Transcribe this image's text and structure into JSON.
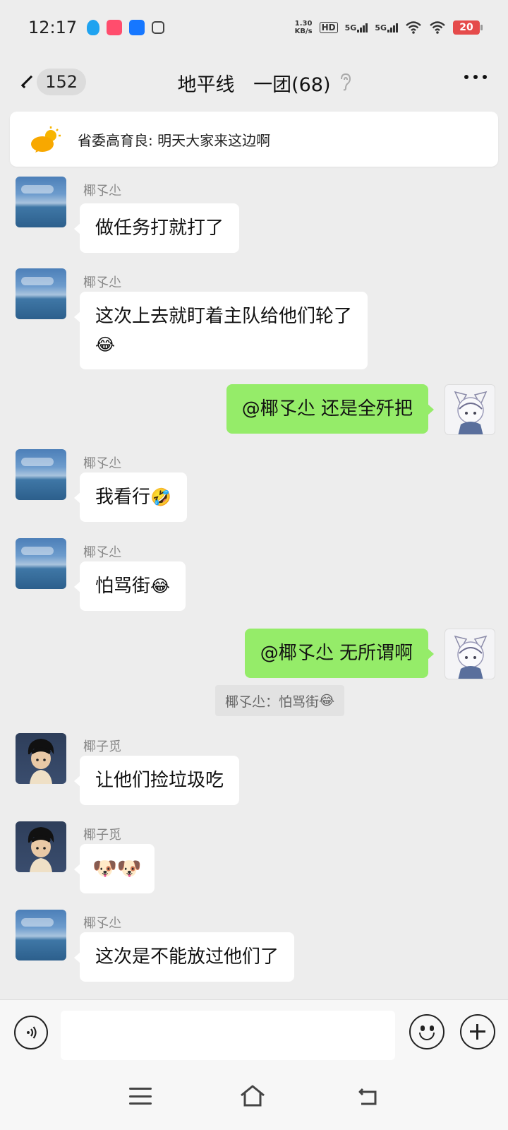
{
  "status_bar": {
    "time": "12:17",
    "net_speed_value": "1.30",
    "net_speed_unit": "KB/s",
    "hd_label": "HD",
    "signal_1": "5G",
    "signal_2": "5G",
    "battery": "20",
    "colors": {
      "battery": "#e54b4b"
    }
  },
  "nav": {
    "back_count": "152",
    "title": "地平线 一团(68)"
  },
  "pinned": {
    "text": "省委高育良: 明天大家来这边啊"
  },
  "messages": [
    {
      "side": "left",
      "sender": "椰孓尐",
      "text": "做任务打就打了",
      "avatar": "sky-sea-avatar"
    },
    {
      "side": "left",
      "sender": "椰孓尐",
      "text": "这次上去就盯着主队给他们轮了",
      "emoji": "😂",
      "avatar": "sky-sea-avatar"
    },
    {
      "side": "right",
      "text": "@椰孓尐  还是全歼把",
      "avatar": "anime-girl-avatar"
    },
    {
      "side": "left",
      "sender": "椰孓尐",
      "text": "我看行",
      "emoji": "🤣",
      "avatar": "sky-sea-avatar"
    },
    {
      "side": "left",
      "sender": "椰孓尐",
      "text": "怕骂街",
      "emoji": "😂",
      "avatar": "sky-sea-avatar"
    },
    {
      "side": "right",
      "text": "@椰孓尐  无所谓啊",
      "avatar": "anime-girl-avatar",
      "quote": "椰孓尐：怕骂街",
      "quote_emoji": "😂"
    },
    {
      "side": "left",
      "sender": "椰子觅",
      "text": "让他们捡垃圾吃",
      "avatar": "anime-boy-avatar"
    },
    {
      "side": "left",
      "sender": "椰子觅",
      "text": "",
      "emoji": "🐶🐶",
      "avatar": "anime-boy-avatar"
    },
    {
      "side": "left",
      "sender": "椰孓尐",
      "text": "这次是不能放过他们了",
      "avatar": "sky-sea-avatar"
    }
  ],
  "input": {
    "placeholder": ""
  },
  "icons": {
    "voice": "voice-icon",
    "emoji": "emoji-icon",
    "plus": "plus-icon",
    "menu": "menu-icon",
    "home": "home-icon",
    "back": "return-icon"
  },
  "colors": {
    "chat_bg": "#ededed",
    "outgoing_bubble": "#95ec69",
    "incoming_bubble": "#ffffff"
  }
}
